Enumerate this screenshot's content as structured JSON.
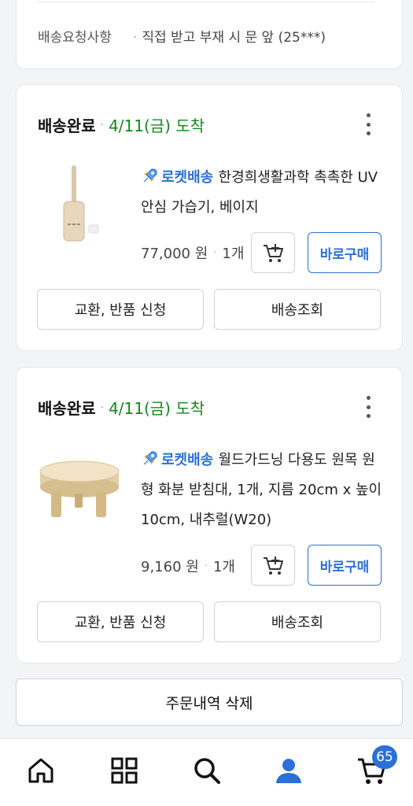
{
  "delivery_request": {
    "label": "배송요청사항",
    "value": "직접 받고 부재 시 문 앞 (25***)"
  },
  "orders": [
    {
      "status": "배송완료",
      "arrival": "4/11(금) 도착",
      "rocket_label": "로켓배송",
      "product_name": "한경희생활과학 촉촉한 UV 안심 가습기, 베이지",
      "price": "77,000 원",
      "quantity": "1개",
      "buy_label": "바로구매",
      "exchange_label": "교환, 반품 신청",
      "tracking_label": "배송조회",
      "thumb_icon": "humidifier-image"
    },
    {
      "status": "배송완료",
      "arrival": "4/11(금) 도착",
      "rocket_label": "로켓배송",
      "product_name": "월드가드닝 다용도 원목 원형 화분 받침대, 1개, 지름 20cm x 높이 10cm, 내추럴(W20)",
      "price": "9,160 원",
      "quantity": "1개",
      "buy_label": "바로구매",
      "exchange_label": "교환, 반품 신청",
      "tracking_label": "배송조회",
      "thumb_icon": "wooden-stand-image"
    }
  ],
  "delete_label": "주문내역 삭제",
  "bottom_nav": {
    "icons": [
      "home-icon",
      "category-grid-icon",
      "search-icon",
      "my-account-icon",
      "cart-icon"
    ],
    "cart_badge": "65",
    "active": "my-account-icon"
  },
  "colors": {
    "accent": "#2b6fd8",
    "arrival_green": "#118a1a",
    "background": "#f3f4f6"
  }
}
